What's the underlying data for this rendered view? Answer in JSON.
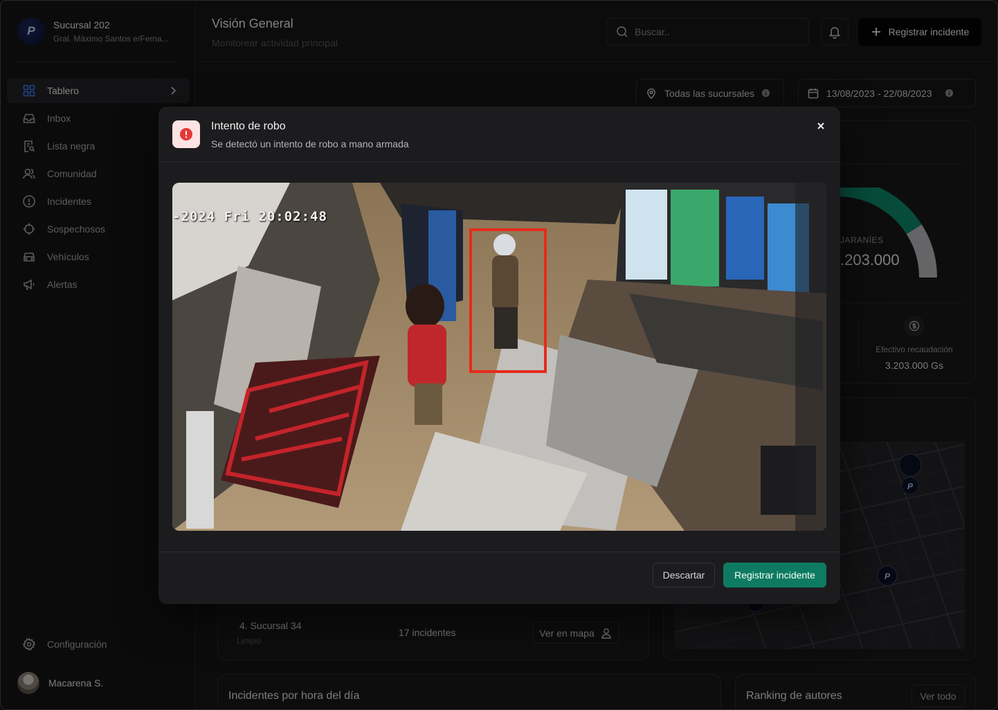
{
  "branch": {
    "name": "Sucursal 202",
    "address": "Gral. Máximo Santos e/Ferna..."
  },
  "nav": [
    {
      "label": "Tablero",
      "icon": "grid-icon",
      "active": true
    },
    {
      "label": "Inbox",
      "icon": "inbox-icon"
    },
    {
      "label": "Lista negra",
      "icon": "document-search-icon"
    },
    {
      "label": "Comunidad",
      "icon": "users-icon"
    },
    {
      "label": "Incidentes",
      "icon": "alert-circle-icon"
    },
    {
      "label": "Sospechosos",
      "icon": "crosshair-icon"
    },
    {
      "label": "Vehículos",
      "icon": "car-icon"
    },
    {
      "label": "Alertas",
      "icon": "megaphone-icon"
    }
  ],
  "footer": {
    "settings": "Configuración",
    "user": "Macarena S."
  },
  "header": {
    "title": "Visión General",
    "subtitle": "Monitorear actividad principal",
    "search_placeholder": "Buscar..",
    "register_button": "Registrar incidente"
  },
  "filters": {
    "branches": "Todas las sucursales",
    "date_range": "13/08/2023 - 22/08/2023"
  },
  "gauge": {
    "label": "JARANÍES",
    "value": ".203.000",
    "fill": 0.82,
    "accent": "#0e8a6c"
  },
  "cash": {
    "label": "Efectivo recaudación",
    "value": "3.203.000 Gs"
  },
  "branch_row": {
    "name": "4. Sucursal 34",
    "status": "Limpio",
    "count": "17 incidentes",
    "map_button": "Ver en mapa"
  },
  "sections": {
    "hourly": "Incidentes por hora del día",
    "ranking": "Ranking de autores",
    "ranking_button": "Ver todo"
  },
  "modal": {
    "title": "Intento de robo",
    "description": "Se detectó un intento de robo a mano armada",
    "timestamp": "-2024 Fri 20:02:48",
    "discard": "Descartar",
    "register": "Registrar incidente",
    "alert_color": "#e53935"
  }
}
